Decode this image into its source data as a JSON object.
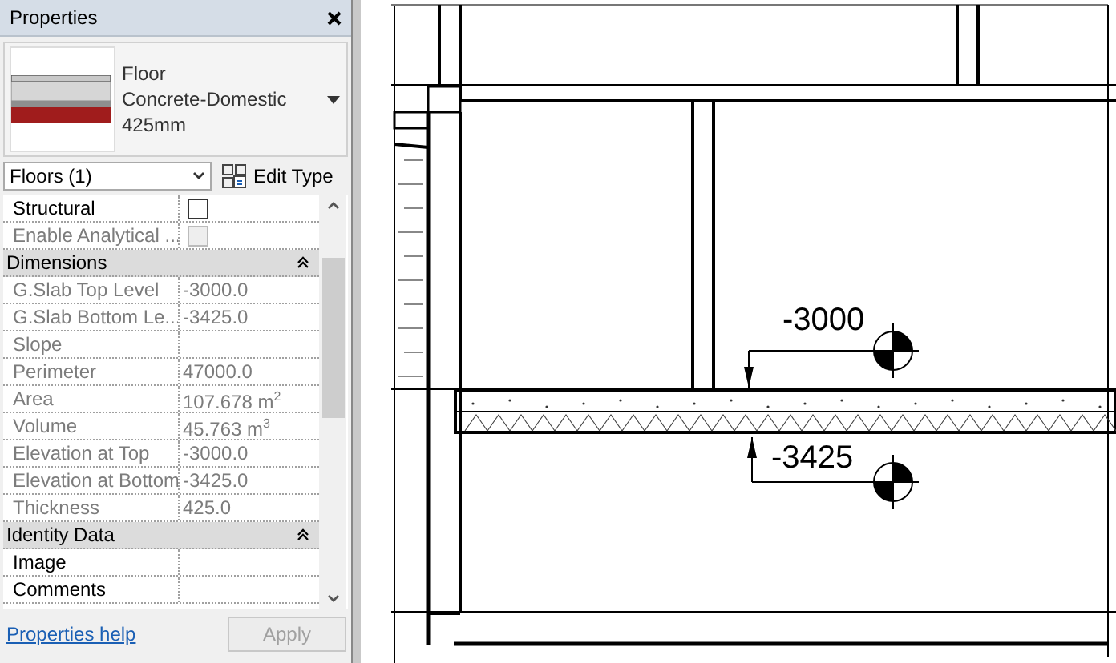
{
  "panel": {
    "title": "Properties",
    "type_selector": {
      "family": "Floor",
      "type": "Concrete-Domestic",
      "thickness": "425mm"
    },
    "filter": {
      "value": "Floors (1)"
    },
    "edit_type_button": {
      "label": "Edit Type"
    },
    "rows": [
      {
        "kind": "checkbox",
        "name": "Structural",
        "checked": false,
        "disabled": false
      },
      {
        "kind": "checkbox",
        "name": "Enable Analytical ...",
        "checked": false,
        "disabled": true
      },
      {
        "kind": "group",
        "name": "Dimensions",
        "expanded": true
      },
      {
        "kind": "value",
        "name": "G.Slab Top Level",
        "value": "-3000.0",
        "readonly": true
      },
      {
        "kind": "value",
        "name": "G.Slab Bottom Le...",
        "value": "-3425.0",
        "readonly": true
      },
      {
        "kind": "value",
        "name": "Slope",
        "readonly": true
      },
      {
        "kind": "value",
        "name": "Perimeter",
        "value": "47000.0",
        "readonly": true
      },
      {
        "kind": "value",
        "name": "Area",
        "value": "107.678 m$^{2}$",
        "readonly": true
      },
      {
        "kind": "value",
        "name": "Volume",
        "value": "45.763 m$^{3}$",
        "readonly": true
      },
      {
        "kind": "value",
        "name": "Elevation at Top",
        "value": "-3000.0",
        "readonly": true
      },
      {
        "kind": "value",
        "name": "Elevation at Bottom",
        "value": "-3425.0",
        "readonly": true
      },
      {
        "kind": "value",
        "name": "Thickness",
        "value": "425.0",
        "readonly": true
      },
      {
        "kind": "group",
        "name": "Identity Data",
        "expanded": true
      },
      {
        "kind": "value",
        "name": "Image",
        "readonly": false
      },
      {
        "kind": "value",
        "name": "Comments",
        "readonly": false
      }
    ],
    "help_link": "Properties help",
    "apply_button": {
      "label": "Apply",
      "disabled": true
    }
  },
  "drawing": {
    "levels": [
      {
        "kind": "top",
        "label": "-3000"
      },
      {
        "kind": "bottom",
        "label": "-3425"
      }
    ]
  }
}
